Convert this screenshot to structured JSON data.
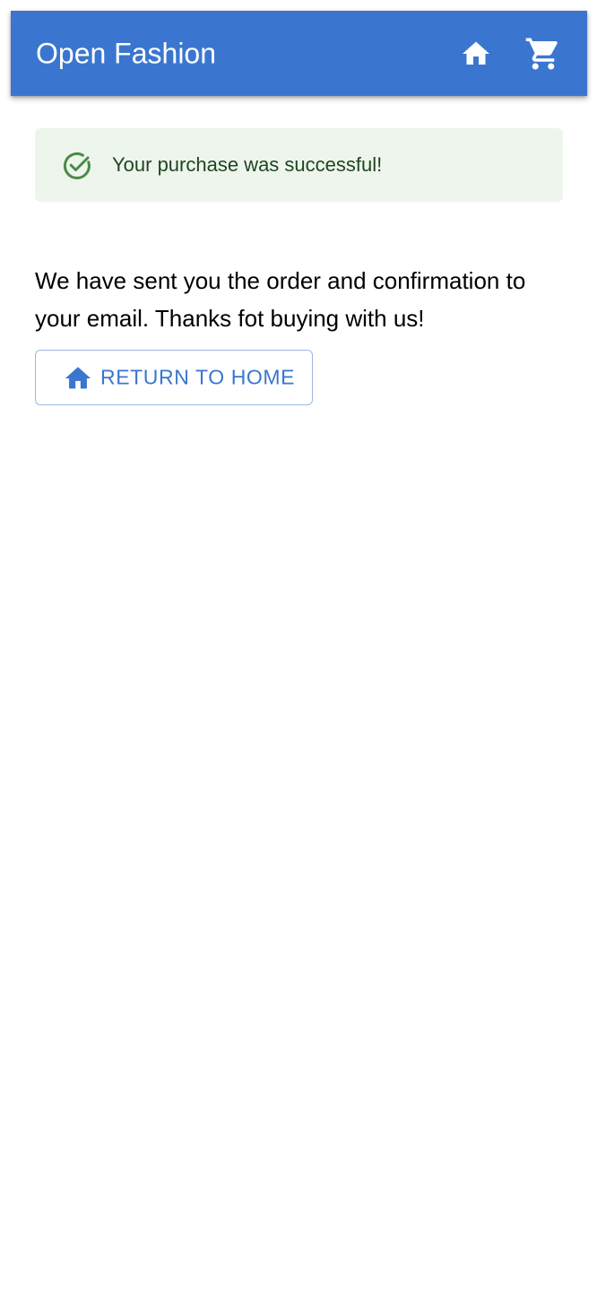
{
  "header": {
    "title": "Open Fashion",
    "home_icon": "home-icon",
    "cart_icon": "shopping-cart-icon"
  },
  "alert": {
    "icon": "check-circle-icon",
    "message": "Your purchase was successful!"
  },
  "content": {
    "message": "We have sent you the order and confirmation to your email. Thanks fot buying with us!"
  },
  "actions": {
    "return_icon": "home-icon",
    "return_label": "RETURN TO HOME"
  },
  "colors": {
    "primary": "#3a76cf",
    "success_bg": "#eef5ed",
    "success_text": "#1f4620",
    "success_icon": "#4a8a45"
  }
}
